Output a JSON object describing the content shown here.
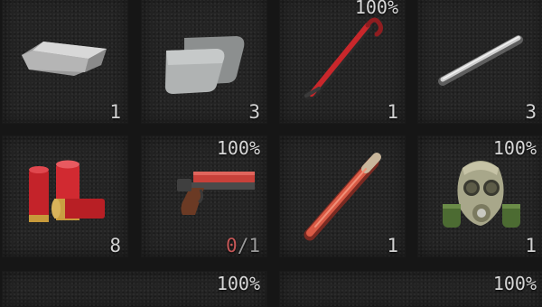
{
  "inventory": {
    "slots": [
      {
        "item": "metal-bar",
        "quantity": "1"
      },
      {
        "item": "armor-plates",
        "quantity": "3"
      },
      {
        "item": "crowbar",
        "condition": "100%",
        "quantity": "1"
      },
      {
        "item": "metal-pipe",
        "quantity": "3"
      },
      {
        "item": "shotgun-shells",
        "quantity": "8"
      },
      {
        "item": "flare-gun",
        "condition": "100%",
        "ammo_loaded": "0",
        "ammo_separator": "/",
        "ammo_capacity": "1"
      },
      {
        "item": "flare-stick",
        "quantity": "1"
      },
      {
        "item": "gas-mask",
        "condition": "100%",
        "quantity": "1"
      },
      {
        "item": "unknown",
        "condition": "100%"
      },
      {
        "item": "unknown",
        "condition": "100%"
      }
    ]
  },
  "colors": {
    "slot_background": "#242424",
    "text": "#d2d2d2",
    "ammo_empty": "#c45757"
  }
}
